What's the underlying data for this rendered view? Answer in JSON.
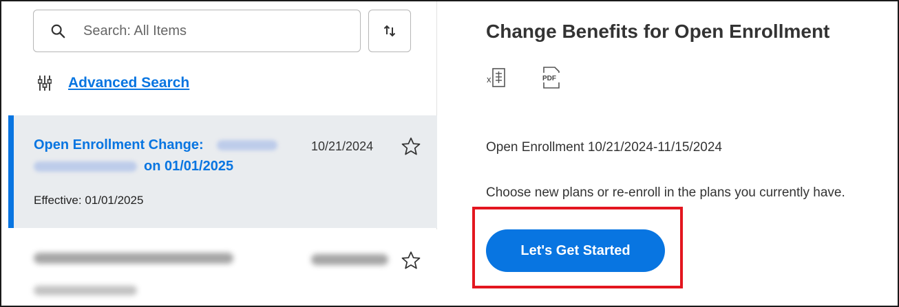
{
  "search": {
    "placeholder": "Search: All Items"
  },
  "advanced_search": {
    "label": "Advanced Search"
  },
  "list": {
    "selected_item": {
      "title_line1": "Open Enrollment Change:",
      "title_line2_suffix": "on 01/01/2025",
      "date": "10/21/2024",
      "effective": "Effective: 01/01/2025"
    }
  },
  "detail": {
    "title": "Change Benefits for Open Enrollment",
    "period": "Open Enrollment 10/21/2024-11/15/2024",
    "description": "Choose new plans or re-enroll in the plans you currently have.",
    "cta_label": "Let's Get Started"
  },
  "icons": {
    "search": "search-icon",
    "sort": "sort-icon",
    "filter": "filter-sliders-icon",
    "star": "star-outline-icon",
    "excel": "excel-export-icon",
    "pdf": "pdf-export-icon"
  },
  "colors": {
    "accent": "#0875e1",
    "selected_bg": "#e9ecef",
    "highlight": "#e3161f"
  }
}
